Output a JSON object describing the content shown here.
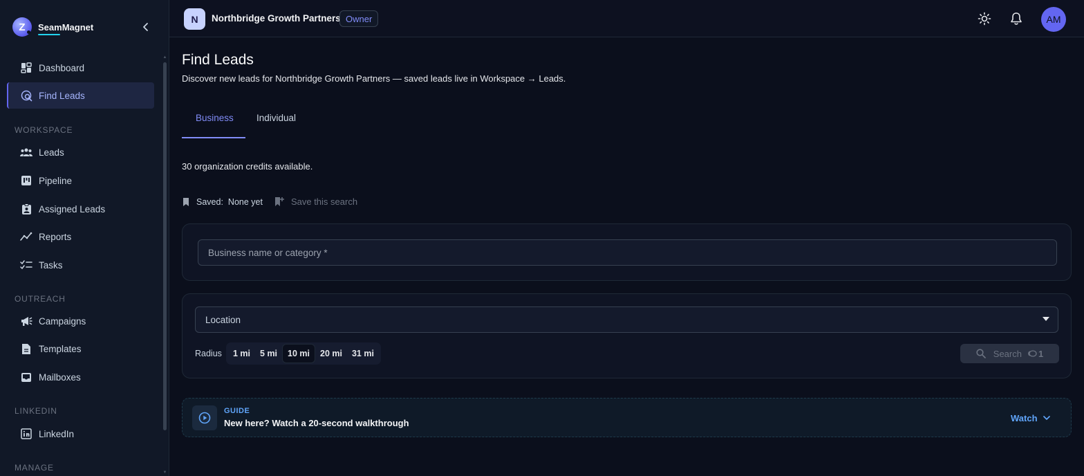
{
  "brand": {
    "name": "SeamMagnet",
    "logo_letter": "Z"
  },
  "sidebar": {
    "items": [
      {
        "label": "Dashboard",
        "icon": "dashboard-icon"
      },
      {
        "label": "Find Leads",
        "icon": "find-leads-icon",
        "active": true
      }
    ],
    "sections": [
      {
        "label": "WORKSPACE",
        "items": [
          {
            "label": "Leads",
            "icon": "users-icon"
          },
          {
            "label": "Pipeline",
            "icon": "pipeline-icon"
          },
          {
            "label": "Assigned Leads",
            "icon": "assigned-icon"
          },
          {
            "label": "Reports",
            "icon": "reports-icon"
          },
          {
            "label": "Tasks",
            "icon": "tasks-icon"
          }
        ]
      },
      {
        "label": "OUTREACH",
        "items": [
          {
            "label": "Campaigns",
            "icon": "megaphone-icon"
          },
          {
            "label": "Templates",
            "icon": "document-icon"
          },
          {
            "label": "Mailboxes",
            "icon": "inbox-icon"
          }
        ]
      },
      {
        "label": "LINKEDIN",
        "items": [
          {
            "label": "LinkedIn",
            "icon": "linkedin-icon"
          }
        ]
      },
      {
        "label": "MANAGE",
        "items": []
      }
    ]
  },
  "topbar": {
    "org_initial": "N",
    "org_name": "Northbridge Growth Partners",
    "role": "Owner",
    "user_initials": "AM"
  },
  "main": {
    "title": "Find Leads",
    "subtitle": "Discover new leads for Northbridge Growth Partners — saved leads live in Workspace → Leads.",
    "tabs": [
      {
        "label": "Business",
        "active": true
      },
      {
        "label": "Individual",
        "active": false
      }
    ],
    "credits": "30 organization credits available.",
    "saved_label": "Saved:",
    "saved_value": "None yet",
    "save_search": "Save this search",
    "business_placeholder": "Business name or category *",
    "location_placeholder": "Location",
    "radius_label": "Radius",
    "radius_options": [
      "1 mi",
      "5 mi",
      "10 mi",
      "20 mi",
      "31 mi"
    ],
    "radius_selected": "10 mi",
    "search_label": "Search",
    "search_cost": "1"
  },
  "guide": {
    "tag": "GUIDE",
    "title": "New here? Watch a 20-second walkthrough",
    "watch": "Watch"
  },
  "colors": {
    "accent": "#818cf8",
    "guide_accent": "#60a5fa",
    "background": "#0b0f1c",
    "sidebar": "#111827"
  }
}
